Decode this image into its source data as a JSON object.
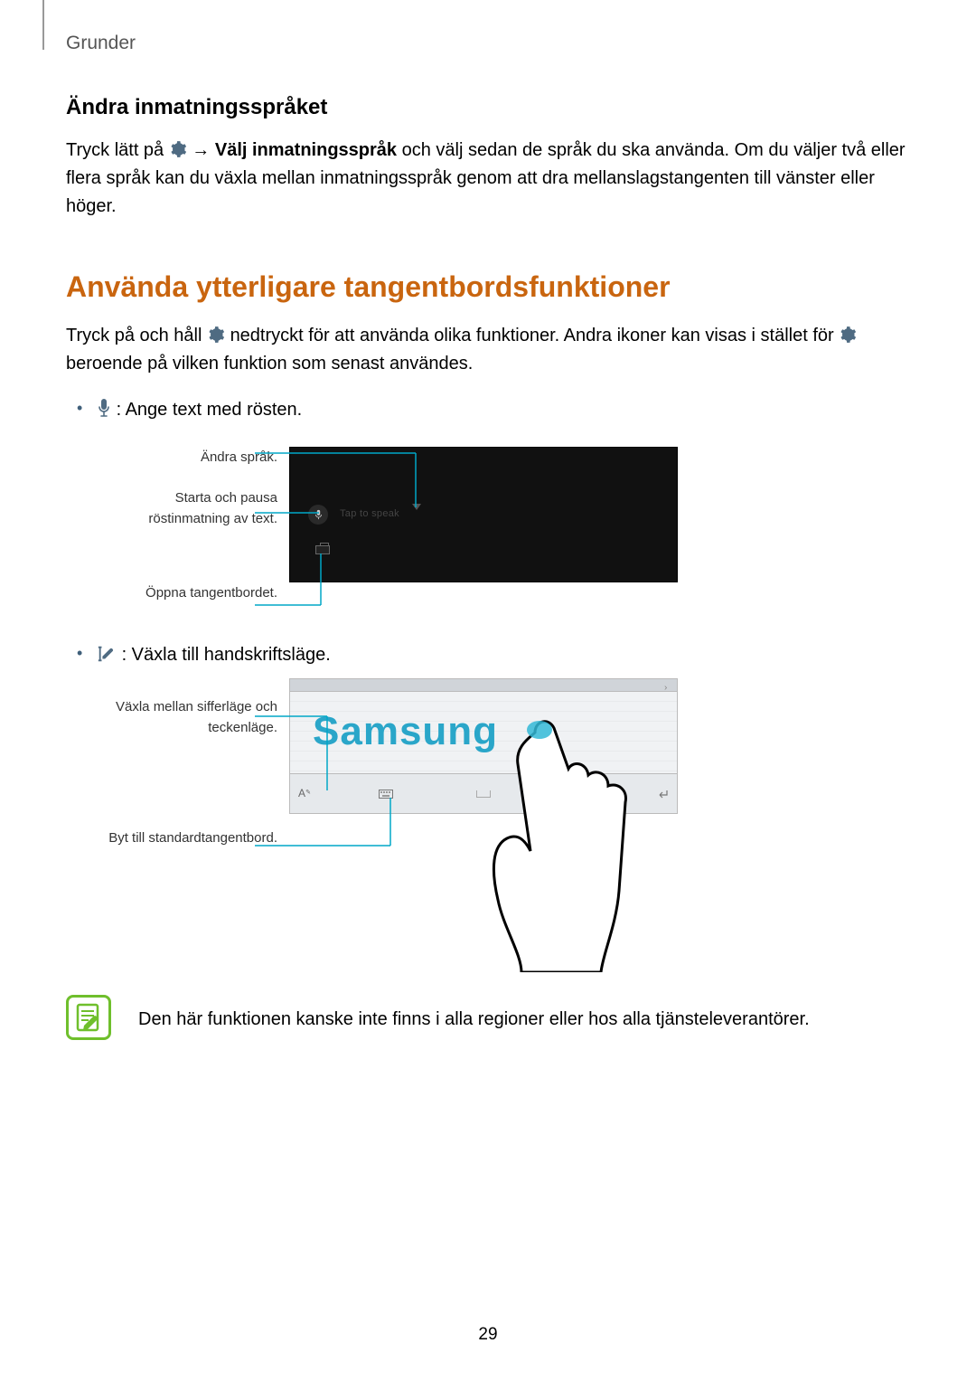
{
  "header": {
    "chapter": "Grunder"
  },
  "section1": {
    "heading": "Ändra inmatningsspråket",
    "para_pre": "Tryck lätt på ",
    "arrow": " → ",
    "bold": "Välj inmatningsspråk",
    "para_post": " och välj sedan de språk du ska använda. Om du väljer två eller flera språk kan du växla mellan inmatningsspråk genom att dra mellanslagstangenten till vänster eller höger."
  },
  "section2": {
    "heading": "Använda ytterligare tangentbordsfunktioner",
    "para_pre": "Tryck på och håll ",
    "para_mid": " nedtryckt för att använda olika funktioner. Andra ikoner kan visas i stället för ",
    "para_post": " beroende på vilken funktion som senast användes."
  },
  "bullets": {
    "b1": ": Ange text med rösten.",
    "b2": ": Växla till handskriftsläge."
  },
  "figure1": {
    "callout_top": "Ändra språk.",
    "callout_mid": "Starta och pausa röstinmatning av text.",
    "callout_bot": "Öppna tangentbordet.",
    "tap_to_speak": "Tap to speak"
  },
  "figure2": {
    "callout_top": "Växla mellan sifferläge och teckenläge.",
    "callout_bot": "Byt till standardtangentbord.",
    "handwriting_text": "Samsung"
  },
  "note": {
    "text": "Den här funktionen kanske inte finns i alla regioner eller hos alla tjänsteleverantörer."
  },
  "page": "29"
}
